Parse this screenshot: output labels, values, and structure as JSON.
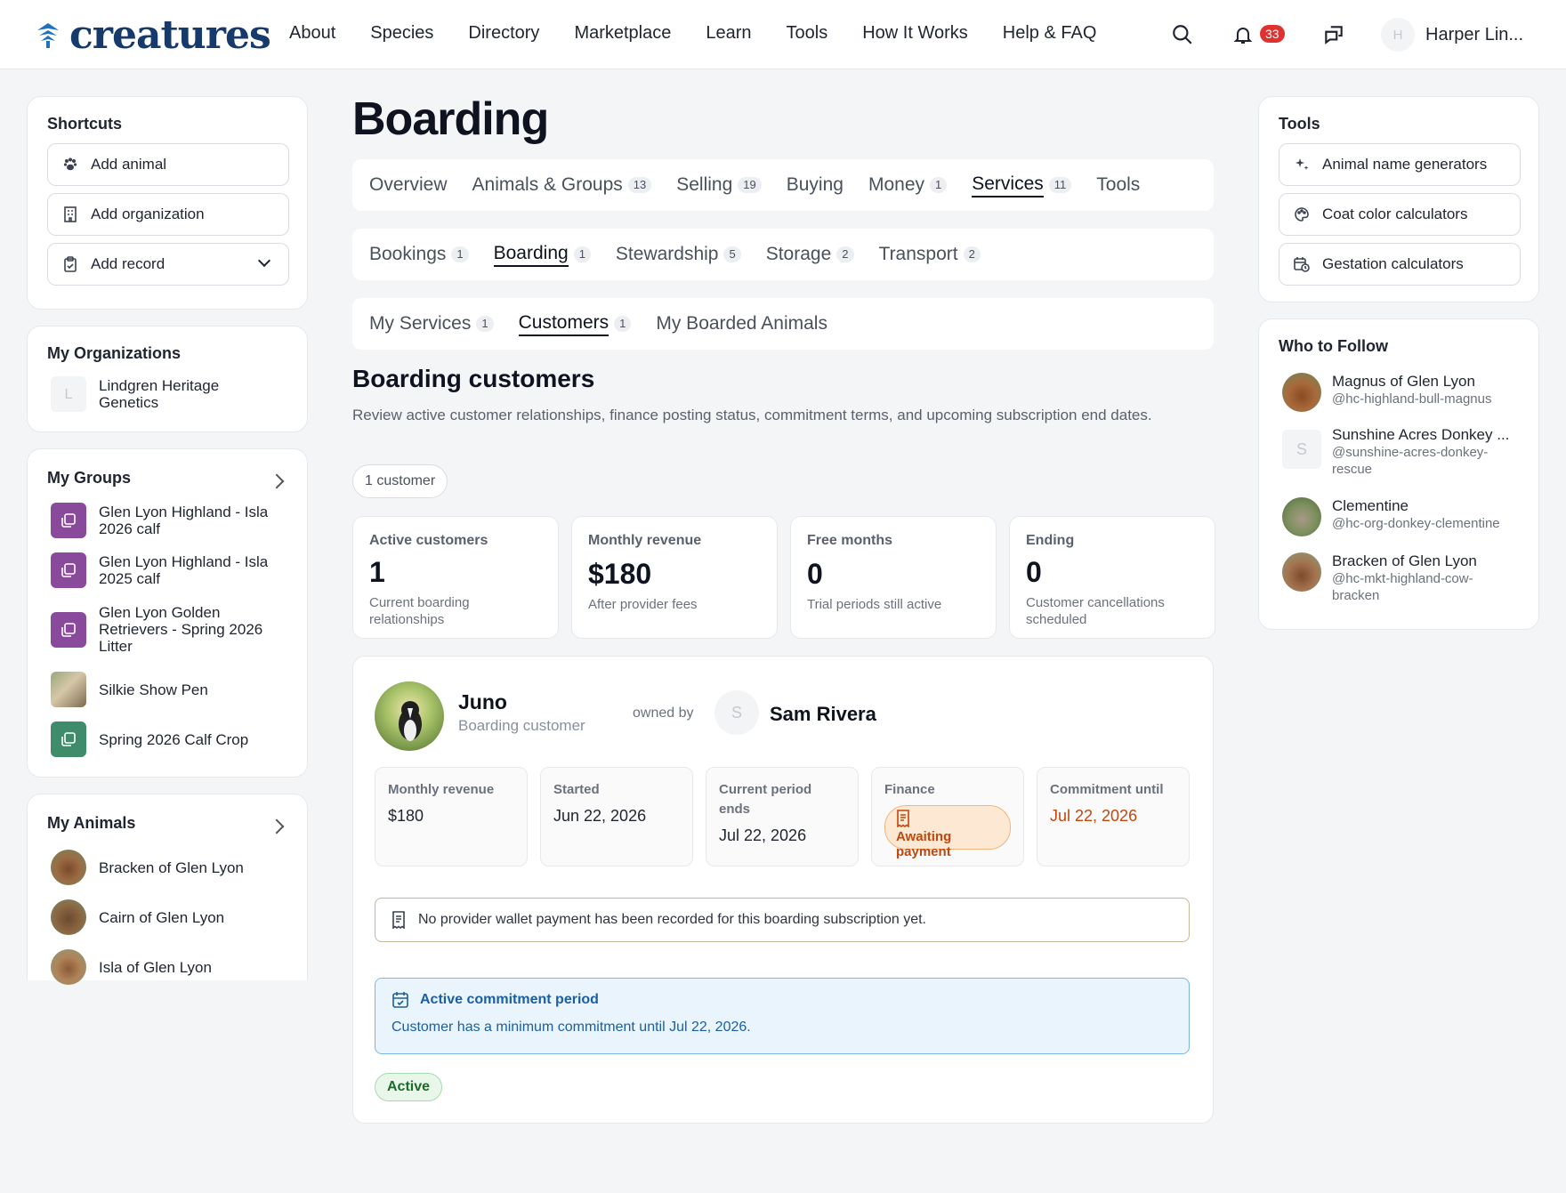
{
  "brand": {
    "name": "creatures"
  },
  "nav": {
    "items": [
      "About",
      "Species",
      "Directory",
      "Marketplace",
      "Learn",
      "Tools",
      "How It Works",
      "Help & FAQ"
    ],
    "notif_count": "33",
    "user_initial": "H",
    "user_name": "Harper Lin..."
  },
  "shortcuts": {
    "title": "Shortcuts",
    "add_animal": "Add animal",
    "add_org": "Add organization",
    "add_record": "Add record"
  },
  "orgs": {
    "title": "My Organizations",
    "items": [
      {
        "initial": "L",
        "name": "Lindgren Heritage Genetics"
      }
    ]
  },
  "groups": {
    "title": "My Groups",
    "items": [
      "Glen Lyon Highland - Isla 2026 calf",
      "Glen Lyon Highland - Isla 2025 calf",
      "Glen Lyon Golden Retrievers - Spring 2026 Litter",
      "Silkie Show Pen",
      "Spring 2026 Calf Crop"
    ]
  },
  "animals": {
    "title": "My Animals",
    "items": [
      "Bracken of Glen Lyon",
      "Cairn of Glen Lyon",
      "Isla of Glen Lyon"
    ]
  },
  "page": {
    "title": "Boarding"
  },
  "tabs1": [
    {
      "label": "Overview",
      "count": ""
    },
    {
      "label": "Animals & Groups",
      "count": "13"
    },
    {
      "label": "Selling",
      "count": "19"
    },
    {
      "label": "Buying",
      "count": ""
    },
    {
      "label": "Money",
      "count": "1"
    },
    {
      "label": "Services",
      "count": "11"
    },
    {
      "label": "Tools",
      "count": ""
    }
  ],
  "tabs2": [
    {
      "label": "Bookings",
      "count": "1"
    },
    {
      "label": "Boarding",
      "count": "1"
    },
    {
      "label": "Stewardship",
      "count": "5"
    },
    {
      "label": "Storage",
      "count": "2"
    },
    {
      "label": "Transport",
      "count": "2"
    }
  ],
  "tabs3": [
    {
      "label": "My Services",
      "count": "1"
    },
    {
      "label": "Customers",
      "count": "1"
    },
    {
      "label": "My Boarded Animals",
      "count": ""
    }
  ],
  "section": {
    "title": "Boarding customers",
    "desc": "Review active customer relationships, finance posting status, commitment terms, and upcoming subscription end dates.",
    "count_pill": "1 customer"
  },
  "stats": [
    {
      "label": "Active customers",
      "value": "1",
      "sub": "Current boarding relationships"
    },
    {
      "label": "Monthly revenue",
      "value": "$180",
      "sub": "After provider fees"
    },
    {
      "label": "Free months",
      "value": "0",
      "sub": "Trial periods still active"
    },
    {
      "label": "Ending",
      "value": "0",
      "sub": "Customer cancellations scheduled"
    }
  ],
  "customer": {
    "animal": "Juno",
    "role": "Boarding customer",
    "owned_by": "owned by",
    "owner_initial": "S",
    "owner": "Sam Rivera",
    "monthly_label": "Monthly revenue",
    "monthly": "$180",
    "started_label": "Started",
    "started": "Jun 22, 2026",
    "period_label": "Current period ends",
    "period": "Jul 22, 2026",
    "finance_label": "Finance",
    "finance": "Awaiting payment",
    "commit_label": "Commitment until",
    "commit": "Jul 22, 2026",
    "notice": "No provider wallet payment has been recorded for this boarding subscription yet.",
    "commit_title": "Active commitment period",
    "commit_text": "Customer has a minimum commitment until Jul 22, 2026.",
    "status": "Active"
  },
  "tools": {
    "title": "Tools",
    "items": [
      "Animal name generators",
      "Coat color calculators",
      "Gestation calculators"
    ]
  },
  "follow": {
    "title": "Who to Follow",
    "items": [
      {
        "name": "Magnus of Glen Lyon",
        "handle": "@hc-highland-bull-magnus"
      },
      {
        "name": "Sunshine Acres Donkey ...",
        "handle": "@sunshine-acres-donkey-rescue",
        "initial": "S"
      },
      {
        "name": "Clementine",
        "handle": "@hc-org-donkey-clementine"
      },
      {
        "name": "Bracken of Glen Lyon",
        "handle": "@hc-mkt-highland-cow-bracken"
      }
    ]
  },
  "colors": {
    "brand": "#163a6b",
    "finance_warn": "#c0470d",
    "commit_blue": "#1c5fa0",
    "active_green": "#1d6b2a"
  }
}
